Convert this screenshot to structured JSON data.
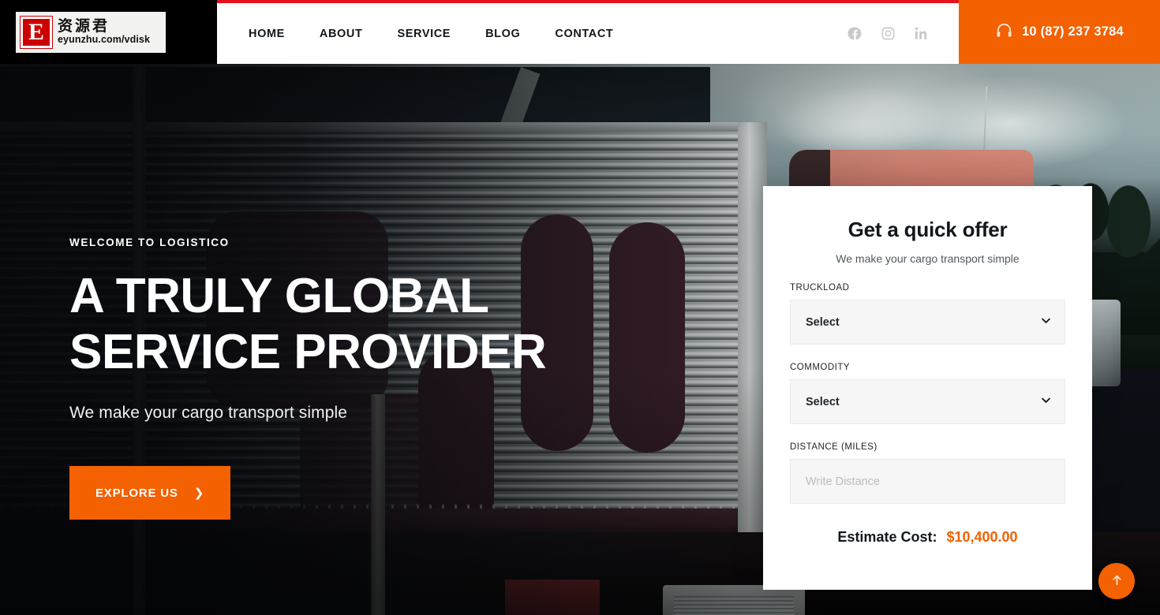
{
  "brand": {
    "logo_mark": "E",
    "logo_cn": "资源君",
    "logo_url": "eyunzhu.com/vdisk"
  },
  "header": {
    "nav": [
      {
        "label": "HOME"
      },
      {
        "label": "ABOUT"
      },
      {
        "label": "SERVICE"
      },
      {
        "label": "BLOG"
      },
      {
        "label": "CONTACT"
      }
    ],
    "social": [
      {
        "name": "facebook-icon"
      },
      {
        "name": "instagram-icon"
      },
      {
        "name": "linkedin-icon"
      }
    ],
    "phone": "10 (87) 237 3784",
    "phone_icon": "headset-icon",
    "accent_color": "#f36100",
    "top_bar_color": "#e4121a"
  },
  "hero": {
    "eyebrow": "WELCOME TO LOGISTICO",
    "headline_line1": "A TRULY GLOBAL",
    "headline_line2": "SERVICE PROVIDER",
    "subline": "We make your cargo transport simple",
    "cta_label": "EXPLORE US",
    "cta_icon": "chevron-right-icon"
  },
  "quote": {
    "title": "Get a quick offer",
    "subtitle": "We make your cargo transport simple",
    "fields": [
      {
        "label": "TRUCKLOAD",
        "type": "select",
        "value": "Select",
        "icon": "chevron-down-icon"
      },
      {
        "label": "COMMODITY",
        "type": "select",
        "value": "Select",
        "icon": "chevron-down-icon"
      },
      {
        "label": "DISTANCE (MILES)",
        "type": "text",
        "value": "",
        "placeholder": "Write Distance"
      }
    ],
    "estimate_label": "Estimate Cost:",
    "estimate_value": "$10,400.00",
    "estimate_color": "#f36100"
  },
  "scroll_top": {
    "icon": "arrow-up-icon"
  }
}
